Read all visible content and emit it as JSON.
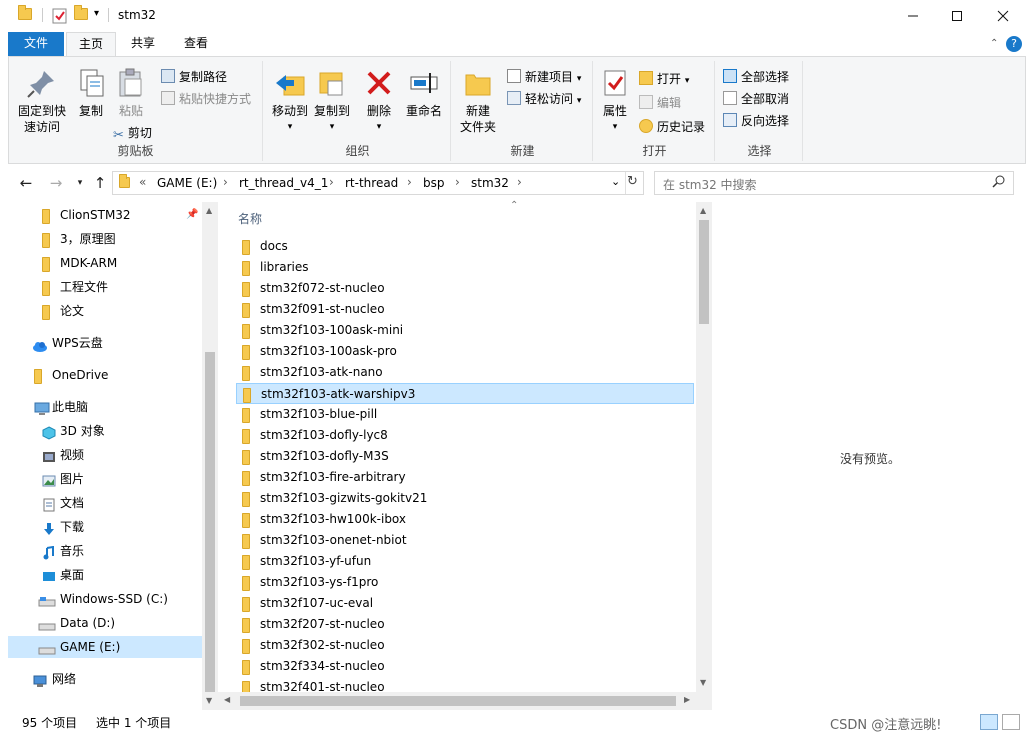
{
  "window": {
    "title": "stm32"
  },
  "ribbon_tabs": [
    "文件",
    "主页",
    "共享",
    "查看"
  ],
  "clipboard": {
    "pin_line1": "固定到快",
    "pin_line2": "速访问",
    "copy": "复制",
    "paste": "粘贴",
    "copy_path": "复制路径",
    "paste_shortcut": "粘贴快捷方式",
    "cut": "剪切",
    "label": "剪贴板"
  },
  "organize": {
    "move_line1": "移动到",
    "copy_line1": "复制到",
    "delete": "删除",
    "rename": "重命名",
    "label": "组织"
  },
  "new": {
    "new_folder_line1": "新建",
    "new_folder_line2": "文件夹",
    "new_item": "新建项目",
    "easy_access": "轻松访问",
    "label": "新建"
  },
  "open": {
    "properties": "属性",
    "open": "打开",
    "edit": "编辑",
    "history": "历史记录",
    "label": "打开"
  },
  "select": {
    "select_all": "全部选择",
    "select_none": "全部取消",
    "invert": "反向选择",
    "label": "选择"
  },
  "address": {
    "prefix": "«",
    "crumbs": [
      "GAME (E:)",
      "rt_thread_v4_1",
      "rt-thread",
      "bsp",
      "stm32"
    ]
  },
  "search": {
    "placeholder": "在 stm32 中搜索"
  },
  "nav": {
    "quick": [
      "ClionSTM32",
      "3，原理图",
      "MDK-ARM",
      "工程文件",
      "论文"
    ],
    "wps": "WPS云盘",
    "onedrive": "OneDrive",
    "thispc": "此电脑",
    "pc_items": [
      "3D 对象",
      "视频",
      "图片",
      "文档",
      "下载",
      "音乐",
      "桌面",
      "Windows-SSD (C:)",
      "Data (D:)",
      "GAME (E:)"
    ],
    "network": "网络"
  },
  "files": {
    "column_name": "名称",
    "items": [
      "docs",
      "libraries",
      "stm32f072-st-nucleo",
      "stm32f091-st-nucleo",
      "stm32f103-100ask-mini",
      "stm32f103-100ask-pro",
      "stm32f103-atk-nano",
      "stm32f103-atk-warshipv3",
      "stm32f103-blue-pill",
      "stm32f103-dofly-lyc8",
      "stm32f103-dofly-M3S",
      "stm32f103-fire-arbitrary",
      "stm32f103-gizwits-gokitv21",
      "stm32f103-hw100k-ibox",
      "stm32f103-onenet-nbiot",
      "stm32f103-yf-ufun",
      "stm32f103-ys-f1pro",
      "stm32f107-uc-eval",
      "stm32f207-st-nucleo",
      "stm32f302-st-nucleo",
      "stm32f334-st-nucleo",
      "stm32f401-st-nucleo"
    ],
    "selected_index": 7
  },
  "preview": {
    "text": "没有预览。"
  },
  "status": {
    "count": "95 个项目",
    "selected": "选中 1 个项目"
  },
  "watermark": "CSDN @注意远眺!",
  "colors": {
    "accent": "#1979ca",
    "selection": "#cce8ff",
    "folder": "#f6c94f"
  }
}
